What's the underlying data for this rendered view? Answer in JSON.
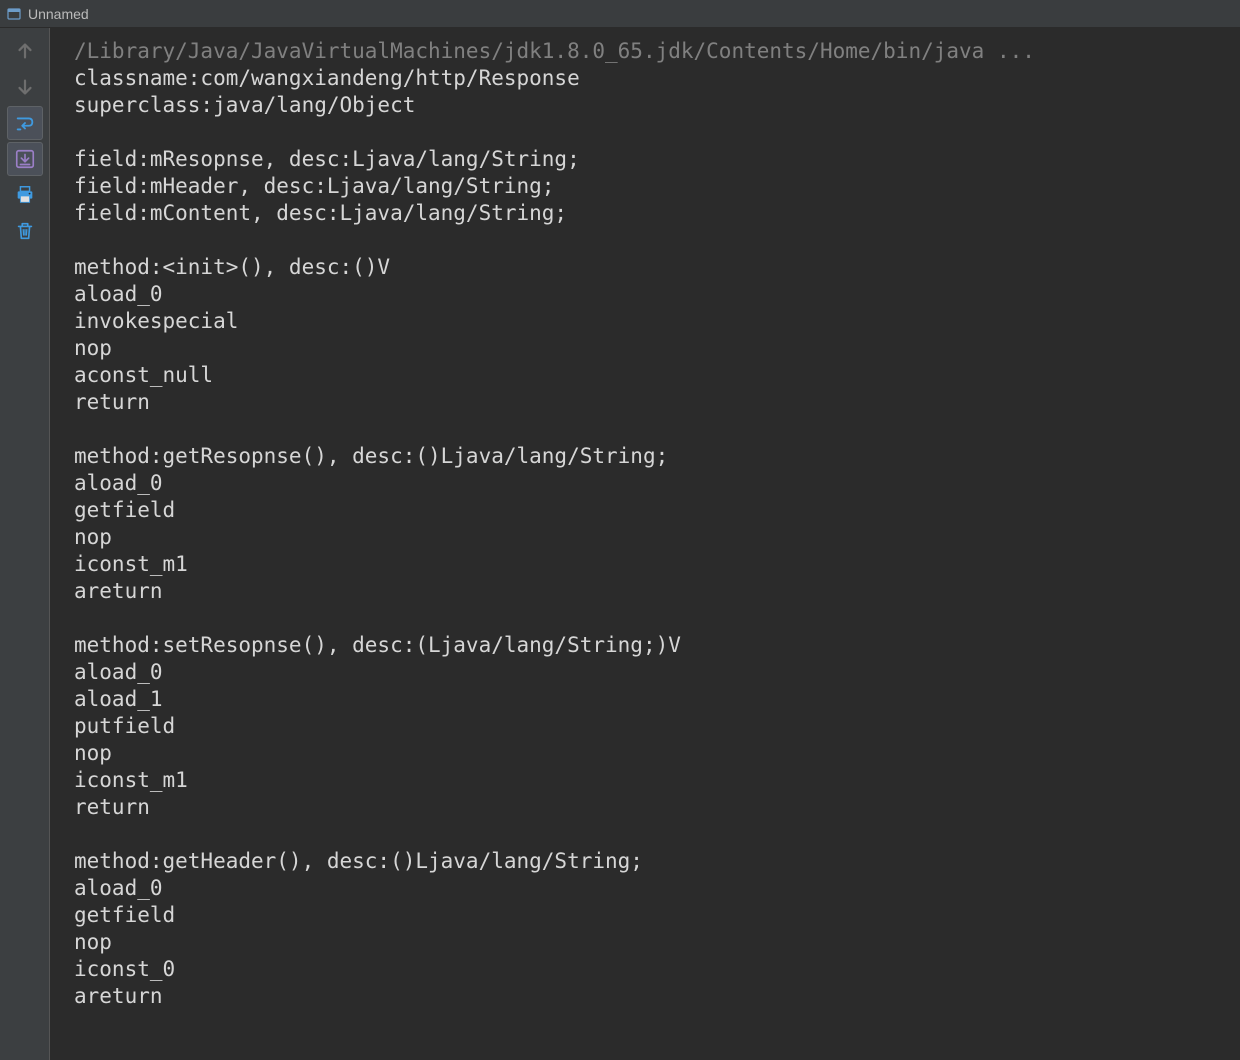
{
  "window": {
    "title": "Unnamed"
  },
  "toolbar": {
    "up": "arrow-up",
    "down": "arrow-down",
    "toggle_wrap": "toggle-wrap",
    "scroll_end": "scroll-to-end",
    "print": "print",
    "clear": "clear-all"
  },
  "console": {
    "lines": [
      {
        "text": "/Library/Java/JavaVirtualMachines/jdk1.8.0_65.jdk/Contents/Home/bin/java ...",
        "dim": true
      },
      {
        "text": "classname:com/wangxiandeng/http/Response"
      },
      {
        "text": "superclass:java/lang/Object"
      },
      {
        "text": ""
      },
      {
        "text": "field:mResopnse, desc:Ljava/lang/String;"
      },
      {
        "text": "field:mHeader, desc:Ljava/lang/String;"
      },
      {
        "text": "field:mContent, desc:Ljava/lang/String;"
      },
      {
        "text": ""
      },
      {
        "text": "method:<init>(), desc:()V"
      },
      {
        "text": "aload_0"
      },
      {
        "text": "invokespecial"
      },
      {
        "text": "nop"
      },
      {
        "text": "aconst_null"
      },
      {
        "text": "return"
      },
      {
        "text": ""
      },
      {
        "text": "method:getResopnse(), desc:()Ljava/lang/String;"
      },
      {
        "text": "aload_0"
      },
      {
        "text": "getfield"
      },
      {
        "text": "nop"
      },
      {
        "text": "iconst_m1"
      },
      {
        "text": "areturn"
      },
      {
        "text": ""
      },
      {
        "text": "method:setResopnse(), desc:(Ljava/lang/String;)V"
      },
      {
        "text": "aload_0"
      },
      {
        "text": "aload_1"
      },
      {
        "text": "putfield"
      },
      {
        "text": "nop"
      },
      {
        "text": "iconst_m1"
      },
      {
        "text": "return"
      },
      {
        "text": ""
      },
      {
        "text": "method:getHeader(), desc:()Ljava/lang/String;"
      },
      {
        "text": "aload_0"
      },
      {
        "text": "getfield"
      },
      {
        "text": "nop"
      },
      {
        "text": "iconst_0"
      },
      {
        "text": "areturn"
      }
    ]
  }
}
